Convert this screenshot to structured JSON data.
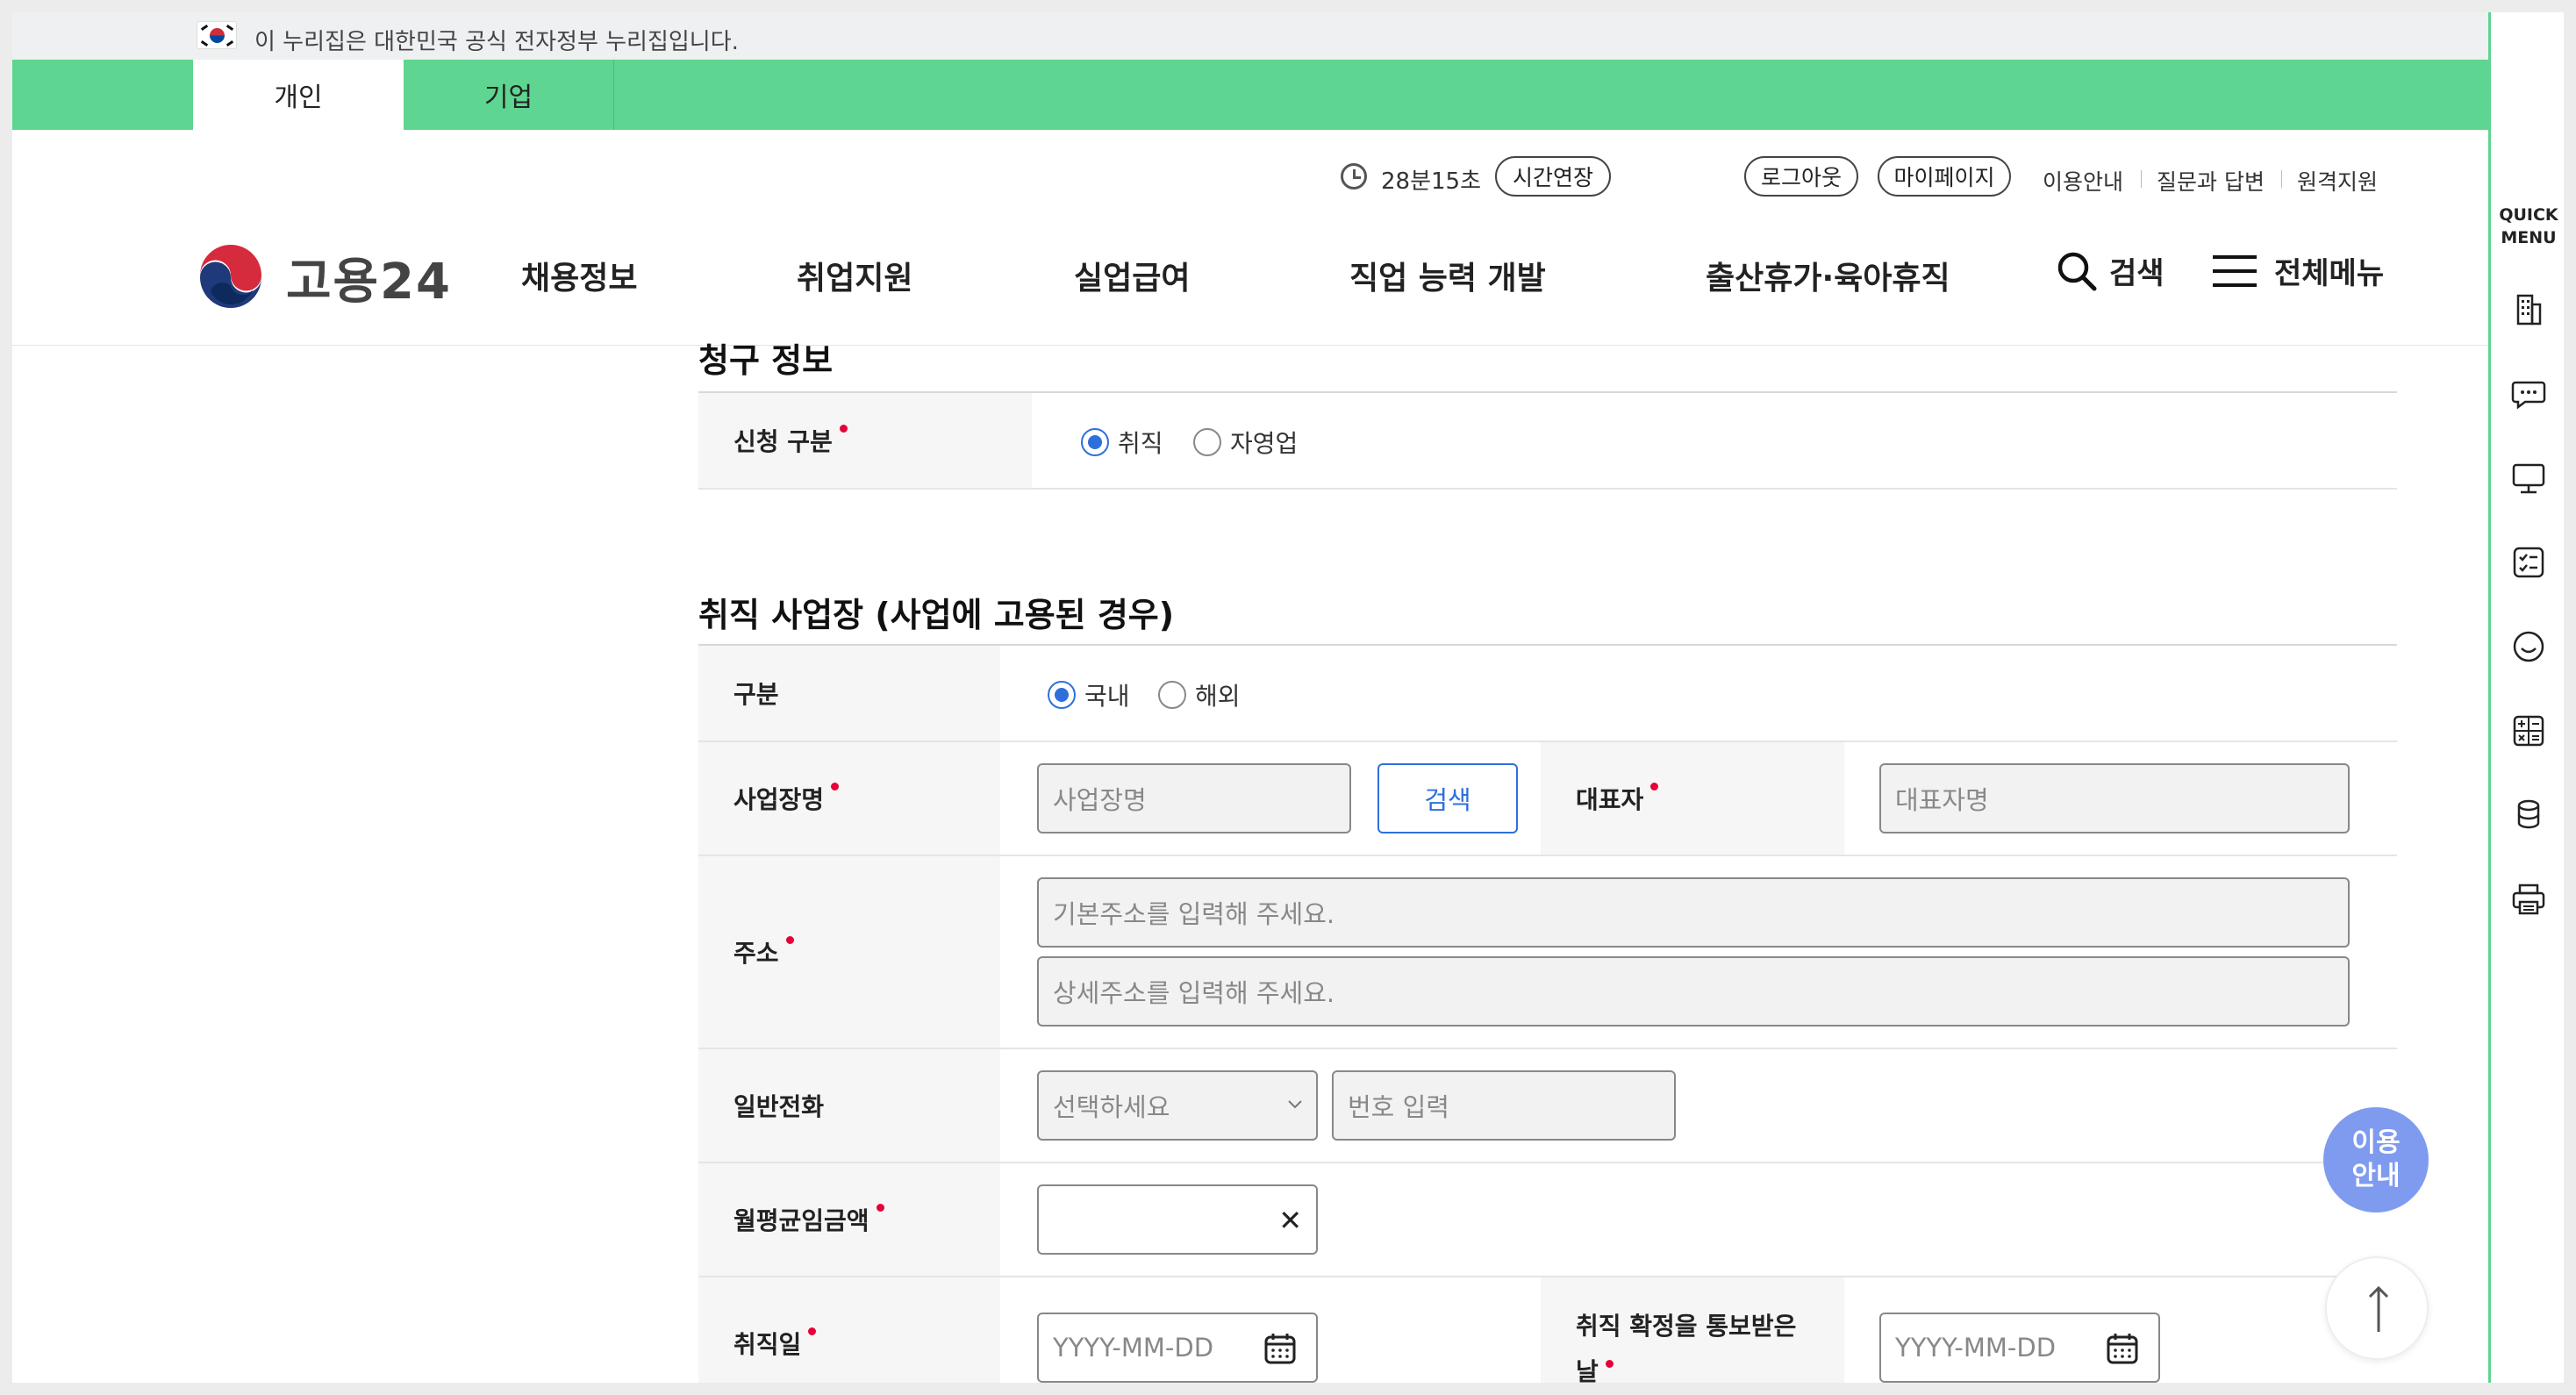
{
  "gov_banner": {
    "text": "이 누리집은 대한민국 공식 전자정부 누리집입니다."
  },
  "audience_tabs": [
    {
      "label": "개인",
      "active": true
    },
    {
      "label": "기업",
      "active": false
    }
  ],
  "utility": {
    "session_time": "28분15초",
    "extend_label": "시간연장",
    "logout_label": "로그아웃",
    "mypage_label": "마이페이지",
    "links": [
      "이용안내",
      "질문과 답변",
      "원격지원"
    ]
  },
  "header": {
    "logo_text": "고용24",
    "nav": [
      "채용정보",
      "취업지원",
      "실업급여",
      "직업 능력 개발",
      "출산휴가·육아휴직"
    ],
    "search_label": "검색",
    "menu_label": "전체메뉴"
  },
  "claim_section": {
    "title": "청구 정보",
    "type_label": "신청 구분",
    "options": [
      "취직",
      "자영업"
    ],
    "selected": "취직"
  },
  "employment_section": {
    "title": "취직 사업장 (사업에 고용된 경우)",
    "division_label": "구분",
    "division_options": [
      "국내",
      "해외"
    ],
    "division_selected": "국내",
    "workplace_label": "사업장명",
    "workplace_placeholder": "사업장명",
    "search_button": "검색",
    "rep_label": "대표자",
    "rep_placeholder": "대표자명",
    "address_label": "주소",
    "address_base_placeholder": "기본주소를 입력해 주세요.",
    "address_detail_placeholder": "상세주소를 입력해 주세요.",
    "phone_label": "일반전화",
    "phone_select_placeholder": "선택하세요",
    "phone_number_placeholder": "번호 입력",
    "wage_label": "월평균임금액",
    "wage_value": "",
    "hire_date_label": "취직일",
    "hire_date_placeholder": "YYYY-MM-DD",
    "notice_date_label_line1": "취직 확정을 통보받은",
    "notice_date_label_line2": "날",
    "notice_date_placeholder": "YYYY-MM-DD"
  },
  "quick_menu": {
    "title_line1": "QUICK",
    "title_line2": "MENU"
  },
  "floating": {
    "guide_line1": "이용",
    "guide_line2": "안내"
  },
  "colors": {
    "brand_green": "#5ed590",
    "accent_blue": "#2f6fdc",
    "required_red": "#e60039",
    "guide_button": "#7f9bf0"
  }
}
